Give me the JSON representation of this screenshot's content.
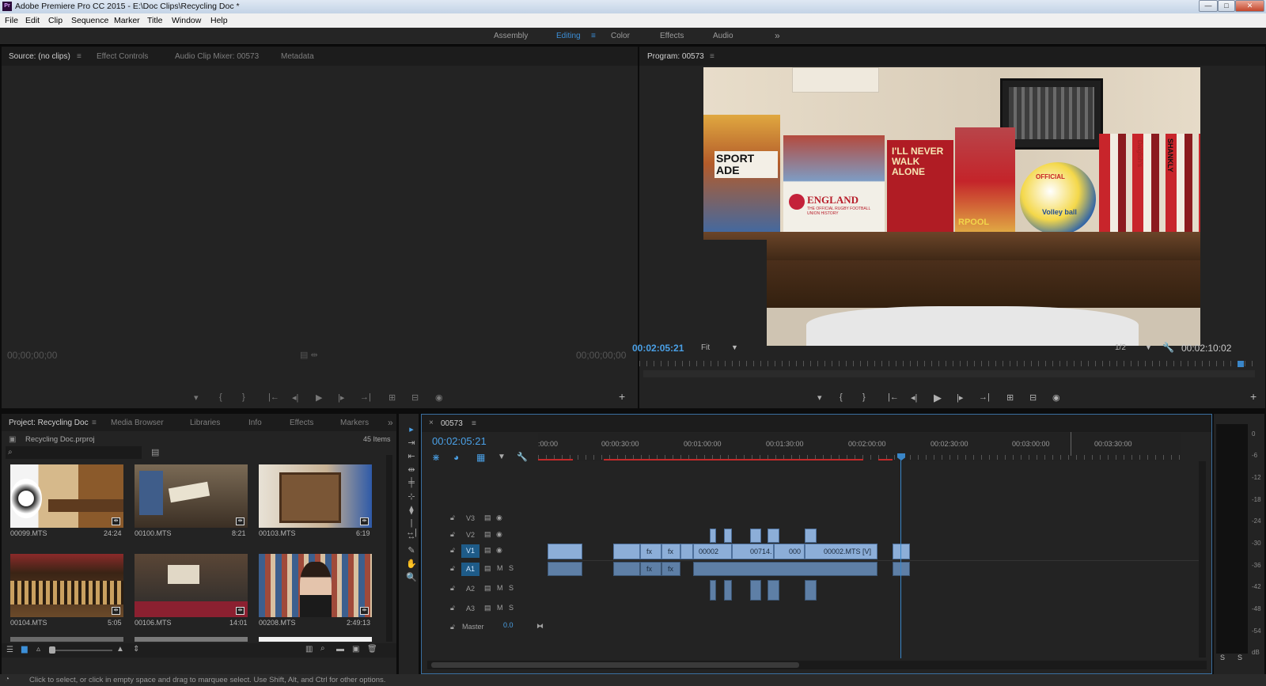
{
  "window": {
    "title": "Adobe Premiere Pro CC 2015 - E:\\Doc Clips\\Recycling Doc *",
    "app_badge": "Pr",
    "controls": {
      "minimize": "—",
      "maximize": "□",
      "close": "✕"
    }
  },
  "menu": [
    "File",
    "Edit",
    "Clip",
    "Sequence",
    "Marker",
    "Title",
    "Window",
    "Help"
  ],
  "workspaces": {
    "items": [
      "Assembly",
      "Editing",
      "Color",
      "Effects",
      "Audio"
    ],
    "active": "Editing",
    "menu_glyph": "≡",
    "overflow": "»"
  },
  "source_panel": {
    "tabs": [
      "Source: (no clips)",
      "Effect Controls",
      "Audio Clip Mixer: 00573",
      "Metadata"
    ],
    "menu_glyph": "≡",
    "timecode_left": "00;00;00;00",
    "timecode_right": "00;00;00;00"
  },
  "program_panel": {
    "title": "Program: 00573",
    "menu_glyph": "≡",
    "timecode": "00:02:05:21",
    "fit": "Fit",
    "resolution": "1/2",
    "duration": "00:02:10:02"
  },
  "video_frame": {
    "book_england": "ENGLAND",
    "book_england_sub": "THE OFFICIAL RUGBY FOOTBALL UNION HISTORY",
    "book_walk": "I'LL NEVER WALK ALONE",
    "book_sport": "SPORT ADE",
    "book_pool": "RPOOL",
    "ball_text": "Volley ball",
    "ball_brand": "OFFICIAL",
    "spine_1": "SHANKLY",
    "spine_2": "Dalglish's"
  },
  "transport": {
    "marker": "▾",
    "in": "{",
    "out": "}",
    "go_in": "|←",
    "step_back": "◂|",
    "play": "▶",
    "step_fwd": "|▸",
    "go_out": "→|",
    "insert": "⊞",
    "overwrite": "⊟",
    "export_frame": "◉",
    "add": "+"
  },
  "project_panel": {
    "tabs": [
      "Project: Recycling Doc",
      "Media Browser",
      "Libraries",
      "Info",
      "Effects",
      "Markers"
    ],
    "menu_glyph": "≡",
    "overflow": "»",
    "file": "Recycling Doc.prproj",
    "items_count": "45 Items",
    "search_placeholder": "",
    "clips": [
      {
        "name": "00099.MTS",
        "duration": "24:24"
      },
      {
        "name": "00100.MTS",
        "duration": "8:21"
      },
      {
        "name": "00103.MTS",
        "duration": "6:19"
      },
      {
        "name": "00104.MTS",
        "duration": "5:05"
      },
      {
        "name": "00106.MTS",
        "duration": "14:01"
      },
      {
        "name": "00208.MTS",
        "duration": "2:49:13"
      }
    ]
  },
  "tools": [
    "▸",
    "⇥",
    "⇤",
    "⇹",
    "╪",
    "⊹",
    "⧫",
    "|↔|",
    "↔",
    "✎",
    "✋",
    "🔍"
  ],
  "timeline": {
    "tab": "00573",
    "menu_glyph": "≡",
    "close": "×",
    "timecode": "00:02:05:21",
    "ruler": [
      ":00:00",
      "00:00:30:00",
      "00:01:00:00",
      "00:01:30:00",
      "00:02:00:00",
      "00:02:30:00",
      "00:03:00:00",
      "00:03:30:00"
    ],
    "video_tracks": [
      "V3",
      "V2",
      "V1"
    ],
    "audio_tracks": [
      "A1",
      "A2",
      "A3"
    ],
    "master_label": "Master",
    "master_value": "0.0",
    "track_m": "M",
    "track_s": "S",
    "clips": {
      "c1": "00002",
      "c2": "00714.",
      "c3": "000",
      "c4": "00002.MTS [V]",
      "fx": "fx"
    }
  },
  "meters": {
    "labels": [
      "0",
      "-6",
      "-12",
      "-18",
      "-24",
      "-30",
      "-36",
      "-42",
      "-48",
      "-54",
      "dB"
    ],
    "solo": [
      "S",
      "S"
    ]
  },
  "status_bar": "Click to select, or click in empty space and drag to marquee select. Use Shift, Alt, and Ctrl for other options.",
  "colors": {
    "accent": "#4aa0e6",
    "clip_video": "#8caed8",
    "clip_audio": "#5e7fa6",
    "playhead": "#3a86c8",
    "render_bar": "#c42a2a"
  }
}
